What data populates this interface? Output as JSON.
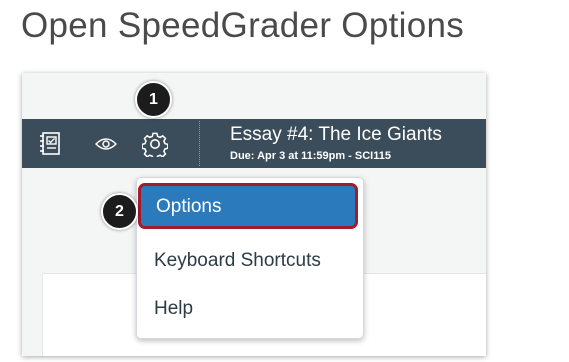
{
  "page": {
    "heading": "Open SpeedGrader Options"
  },
  "toolbar": {
    "assignment_title": "Essay #4: The Ice Giants",
    "due_text": "Due: Apr 3 at 11:59pm - SCI115",
    "icons": [
      "gradebook-icon",
      "eye-icon",
      "gear-icon"
    ]
  },
  "menu": {
    "items": [
      {
        "label": "Options",
        "selected": true
      },
      {
        "label": "Keyboard Shortcuts",
        "selected": false
      },
      {
        "label": "Help",
        "selected": false
      }
    ]
  },
  "callouts": {
    "step1": "1",
    "step2": "2"
  },
  "colors": {
    "toolbar_bg": "#3b4c5a",
    "selected_item_bg": "#2b7abc",
    "highlight_border": "#a31c2c",
    "badge_bg": "#1c1c1c"
  }
}
